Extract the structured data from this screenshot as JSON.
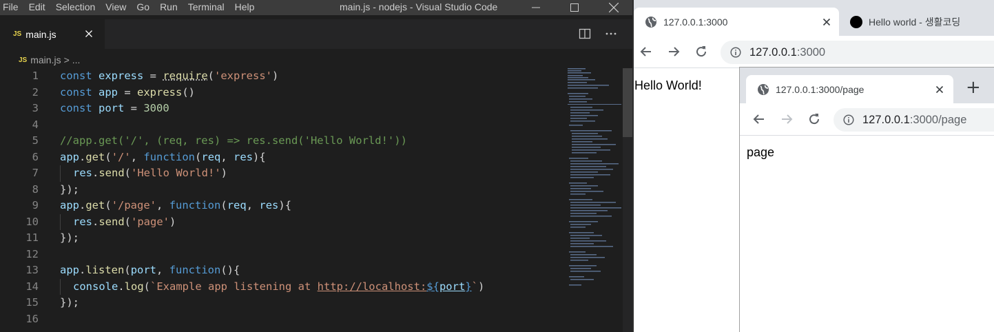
{
  "vscode": {
    "menu": [
      "File",
      "Edit",
      "Selection",
      "View",
      "Go",
      "Run",
      "Terminal",
      "Help"
    ],
    "window_title": "main.js - nodejs - Visual Studio Code",
    "tab": {
      "badge": "JS",
      "name": "main.js"
    },
    "breadcrumb": {
      "badge": "JS",
      "file": "main.js",
      "sep": ">",
      "rest": "..."
    },
    "line_numbers": [
      "1",
      "2",
      "3",
      "4",
      "5",
      "6",
      "7",
      "8",
      "9",
      "10",
      "11",
      "12",
      "13",
      "14",
      "15",
      "16"
    ],
    "code": {
      "l1": {
        "const": "const",
        "name": "express",
        "eq": " = ",
        "fn": "require",
        "p1": "(",
        "str": "'express'",
        "p2": ")"
      },
      "l2": {
        "const": "const",
        "name": "app",
        "eq": " = ",
        "fn": "express",
        "rest": "()"
      },
      "l3": {
        "const": "const",
        "name": "port",
        "eq": " = ",
        "num": "3000"
      },
      "l5": {
        "comment": "//app.get('/', (req, res) => res.send('Hello World!'))"
      },
      "l6": {
        "obj": "app",
        "dot": ".",
        "fn": "get",
        "p1": "(",
        "str": "'/'",
        "comma": ", ",
        "kw": "function",
        "p2": "(",
        "a1": "req",
        "c2": ", ",
        "a2": "res",
        "p3": "){"
      },
      "l7": {
        "obj": "res",
        "dot": ".",
        "fn": "send",
        "p1": "(",
        "str": "'Hello World!'",
        "p2": ")"
      },
      "l8": {
        "text": "});"
      },
      "l9": {
        "obj": "app",
        "dot": ".",
        "fn": "get",
        "p1": "(",
        "str": "'/page'",
        "comma": ", ",
        "kw": "function",
        "p2": "(",
        "a1": "req",
        "c2": ", ",
        "a2": "res",
        "p3": "){"
      },
      "l10": {
        "obj": "res",
        "dot": ".",
        "fn": "send",
        "p1": "(",
        "str": "'page'",
        "p2": ")"
      },
      "l11": {
        "text": "});"
      },
      "l13": {
        "obj": "app",
        "dot": ".",
        "fn": "listen",
        "p1": "(",
        "a1": "port",
        "comma": ", ",
        "kw": "function",
        "p2": "(){"
      },
      "l14": {
        "obj": "console",
        "dot": ".",
        "fn": "log",
        "p1": "(",
        "s1": "`Example app listening at ",
        "url": "http://localhost:",
        "t1": "${",
        "var": "port",
        "t2": "}",
        "s2": "`",
        "p2": ")"
      },
      "l15": {
        "text": "});"
      }
    }
  },
  "browser1": {
    "tabs": [
      {
        "title": "127.0.0.1:3000",
        "active": true
      },
      {
        "title": "Hello world - 생활코딩",
        "active": false
      }
    ],
    "url_host": "127.0.0.1",
    "url_rest": ":3000",
    "content": "Hello World!"
  },
  "browser2": {
    "tabs": [
      {
        "title": "127.0.0.1:3000/page",
        "active": true
      }
    ],
    "new_tab": "+",
    "url_host": "127.0.0.1",
    "url_rest": ":3000/page",
    "content": "page"
  },
  "colors": {
    "vscode_bg": "#1e1e1e",
    "keyword": "#569cd6",
    "string": "#ce9178",
    "comment": "#6a9955",
    "function": "#dcdcaa",
    "variable": "#9cdcfe",
    "number": "#b5cea8",
    "js_badge": "#e8d44d",
    "chrome_tabstrip": "#dee1e6"
  },
  "icons": [
    "split-editor-icon",
    "more-actions-icon",
    "globe-icon",
    "back-arrow-icon",
    "forward-arrow-icon",
    "reload-icon",
    "info-icon",
    "close-icon",
    "new-tab-icon",
    "minimize-icon",
    "maximize-icon"
  ]
}
